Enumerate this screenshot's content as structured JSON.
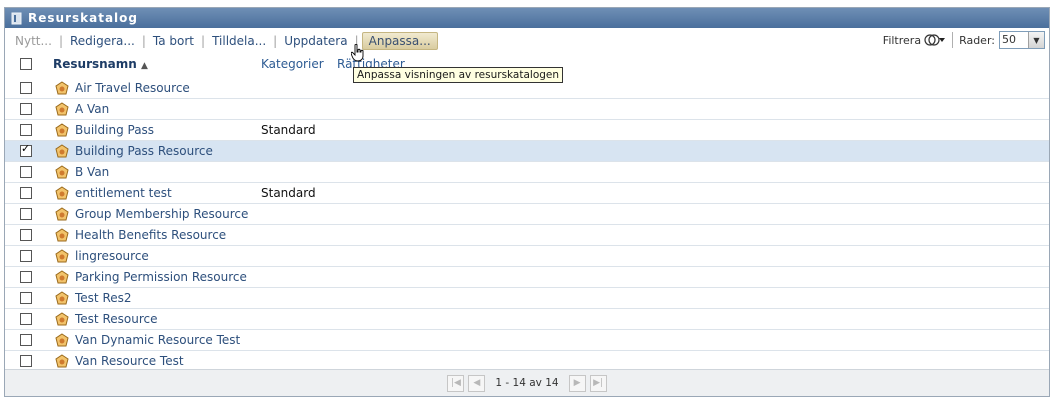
{
  "window": {
    "title": "Resurskatalog"
  },
  "toolbar": {
    "new_label": "Nytt...",
    "edit_label": "Redigera...",
    "delete_label": "Ta bort",
    "assign_label": "Tilldela...",
    "refresh_label": "Uppdatera",
    "customize_label": "Anpassa...",
    "filter_label": "Filtrera",
    "rows_label": "Rader:",
    "rows_value": "50"
  },
  "tooltip": {
    "text": "Anpassa visningen av resurskatalogen"
  },
  "table": {
    "headers": {
      "name": "Resursnamn",
      "category": "Kategorier",
      "rating": "Rättigheter"
    },
    "rows": [
      {
        "name": "Air Travel Resource",
        "category": ""
      },
      {
        "name": "A Van",
        "category": ""
      },
      {
        "name": "Building Pass",
        "category": "Standard"
      },
      {
        "name": "Building Pass Resource",
        "category": ""
      },
      {
        "name": "B Van",
        "category": ""
      },
      {
        "name": "entitlement test",
        "category": "Standard"
      },
      {
        "name": "Group Membership Resource",
        "category": ""
      },
      {
        "name": "Health Benefits Resource",
        "category": ""
      },
      {
        "name": "lingresource",
        "category": ""
      },
      {
        "name": "Parking Permission Resource",
        "category": ""
      },
      {
        "name": "Test Res2",
        "category": ""
      },
      {
        "name": "Test Resource",
        "category": ""
      },
      {
        "name": "Van Dynamic Resource Test",
        "category": ""
      },
      {
        "name": "Van Resource Test",
        "category": ""
      }
    ]
  },
  "pager": {
    "text": "1 - 14 av 14"
  },
  "colors": {
    "title_bar": "#4a6f9c",
    "selected_row": "#d7e4f2",
    "link": "#2d4f7c"
  }
}
